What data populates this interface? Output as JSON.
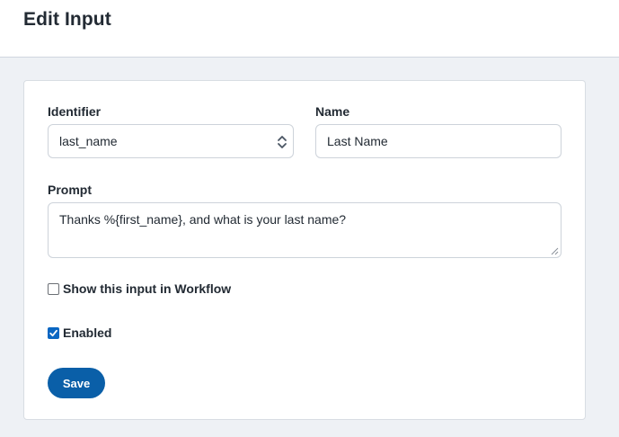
{
  "header": {
    "title": "Edit Input"
  },
  "form": {
    "identifier": {
      "label": "Identifier",
      "value": "last_name",
      "icon": "select-arrows-icon"
    },
    "name": {
      "label": "Name",
      "value": "Last Name"
    },
    "prompt": {
      "label": "Prompt",
      "value": "Thanks %{first_name}, and what is your last name?"
    },
    "show_in_workflow": {
      "label": "Show this input in Workflow",
      "checked": false
    },
    "enabled": {
      "label": "Enabled",
      "checked": true
    },
    "save_label": "Save"
  },
  "colors": {
    "accent": "#0a5fa8",
    "checkbox_checked": "#0a66c2",
    "page_bg": "#eef1f5"
  }
}
